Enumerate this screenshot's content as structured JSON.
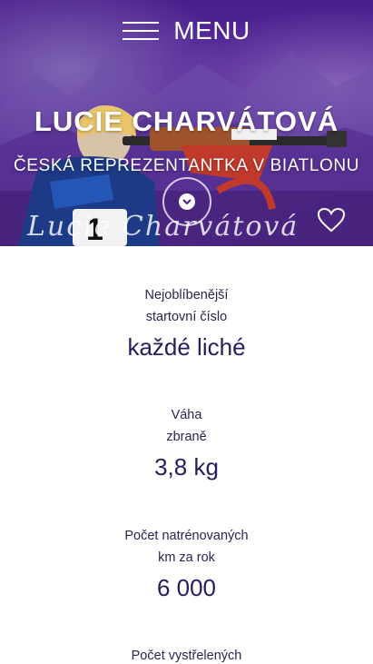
{
  "menu": {
    "label": "MENU",
    "icon": "hamburger-icon"
  },
  "hero": {
    "title": "LUCIE CHARVÁTOVÁ",
    "subtitle": "ČESKÁ REPREZENTANTKA V BIATLONU",
    "signature": "Lucie Charvátová",
    "scroll_icon": "chevron-down-icon",
    "heart_icon": "heart-icon"
  },
  "stats": [
    {
      "label_line1": "Nejoblíbenější",
      "label_line2": "startovní číslo",
      "value": "každé liché"
    },
    {
      "label_line1": "Váha",
      "label_line2": "zbraně",
      "value": "3,8 kg"
    },
    {
      "label_line1": "Počet natrénovaných",
      "label_line2": "km za rok",
      "value": "6 000"
    },
    {
      "label_line1": "Počet vystřelených",
      "label_line2": "",
      "value": ""
    }
  ],
  "colors": {
    "hero_purple": "#4a1f8c",
    "stat_value": "#2a1a5e",
    "stat_label": "#2e2250",
    "background": "#ffffff"
  }
}
